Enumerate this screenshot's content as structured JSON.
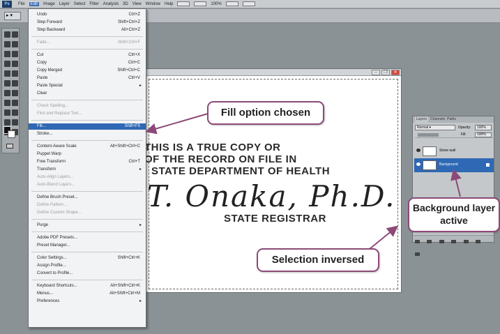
{
  "menubar": {
    "logo": "Ps",
    "items": [
      "File",
      "Edit",
      "Image",
      "Layer",
      "Select",
      "Filter",
      "Analysis",
      "3D",
      "View",
      "Window",
      "Help"
    ],
    "active_item": "Edit",
    "zoom": "100%"
  },
  "edit_menu": {
    "items": [
      {
        "label": "Undo",
        "shortcut": "Ctrl+Z",
        "disabled": false
      },
      {
        "label": "Step Forward",
        "shortcut": "Shift+Ctrl+Z",
        "disabled": false
      },
      {
        "label": "Step Backward",
        "shortcut": "Alt+Ctrl+Z",
        "disabled": false
      },
      {
        "label": "Fade...",
        "shortcut": "Shift+Ctrl+F",
        "disabled": true
      },
      {
        "label": "Cut",
        "shortcut": "Ctrl+X",
        "disabled": false
      },
      {
        "label": "Copy",
        "shortcut": "Ctrl+C",
        "disabled": false
      },
      {
        "label": "Copy Merged",
        "shortcut": "Shift+Ctrl+C",
        "disabled": false
      },
      {
        "label": "Paste",
        "shortcut": "Ctrl+V",
        "disabled": false
      },
      {
        "label": "Paste Special",
        "shortcut": "",
        "disabled": false,
        "submenu": true
      },
      {
        "label": "Clear",
        "shortcut": "",
        "disabled": false
      },
      {
        "label": "Check Spelling...",
        "shortcut": "",
        "disabled": true
      },
      {
        "label": "Find and Replace Text...",
        "shortcut": "",
        "disabled": true
      },
      {
        "label": "Fill...",
        "shortcut": "Shift+F5",
        "disabled": false,
        "highlight": true
      },
      {
        "label": "Stroke...",
        "shortcut": "",
        "disabled": false
      },
      {
        "label": "Content-Aware Scale",
        "shortcut": "Alt+Shift+Ctrl+C",
        "disabled": false
      },
      {
        "label": "Puppet Warp",
        "shortcut": "",
        "disabled": false
      },
      {
        "label": "Free Transform",
        "shortcut": "Ctrl+T",
        "disabled": false
      },
      {
        "label": "Transform",
        "shortcut": "",
        "disabled": false,
        "submenu": true
      },
      {
        "label": "Auto-Align Layers...",
        "shortcut": "",
        "disabled": true
      },
      {
        "label": "Auto-Blend Layers...",
        "shortcut": "",
        "disabled": true
      },
      {
        "label": "Define Brush Preset...",
        "shortcut": "",
        "disabled": false
      },
      {
        "label": "Define Pattern...",
        "shortcut": "",
        "disabled": true
      },
      {
        "label": "Define Custom Shape...",
        "shortcut": "",
        "disabled": true
      },
      {
        "label": "Purge",
        "shortcut": "",
        "disabled": false,
        "submenu": true
      },
      {
        "label": "Adobe PDF Presets...",
        "shortcut": "",
        "disabled": false
      },
      {
        "label": "Preset Manager...",
        "shortcut": "",
        "disabled": false
      },
      {
        "label": "Color Settings...",
        "shortcut": "Shift+Ctrl+K",
        "disabled": false
      },
      {
        "label": "Assign Profile...",
        "shortcut": "",
        "disabled": false
      },
      {
        "label": "Convert to Profile...",
        "shortcut": "",
        "disabled": false
      },
      {
        "label": "Keyboard Shortcuts...",
        "shortcut": "Alt+Shift+Ctrl+K",
        "disabled": false
      },
      {
        "label": "Menus...",
        "shortcut": "Alt+Shift+Ctrl+M",
        "disabled": false
      },
      {
        "label": "Preferences",
        "shortcut": "",
        "disabled": false,
        "submenu": true
      }
    ]
  },
  "document": {
    "line1": "THIS IS A TRUE COPY OR",
    "line2": "OF THE RECORD ON FILE IN",
    "line3": "STATE DEPARTMENT OF HEALTH",
    "signature": "T. Onaka, Ph.D.",
    "registrar": "STATE REGISTRAR"
  },
  "layers_panel": {
    "tabs": [
      "Layers",
      "Channels",
      "Paths"
    ],
    "blend_mode": "Normal",
    "opacity_label": "Opacity:",
    "opacity": "100%",
    "fill_label": "Fill:",
    "fill": "100%",
    "layers": [
      {
        "name": "Stone wall",
        "active": false
      },
      {
        "name": "Background",
        "active": true
      }
    ]
  },
  "callouts": {
    "fill": "Fill option chosen",
    "selection": "Selection inversed",
    "background": "Background layer active"
  },
  "colors": {
    "highlight": "#2f68b4",
    "callout_border": "#8c4a78",
    "workspace": "#8a9296"
  }
}
